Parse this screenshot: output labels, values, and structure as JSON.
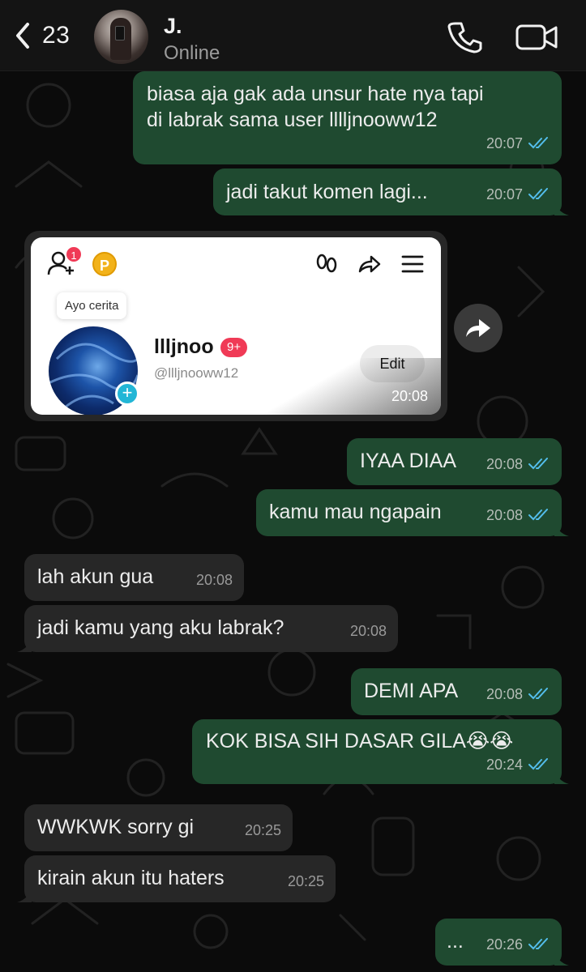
{
  "header": {
    "back_count": "23",
    "contact_name": "J.",
    "contact_status": "Online"
  },
  "colors": {
    "outgoing_bubble": "#1f4a30",
    "incoming_bubble": "#272727",
    "read_tick": "#53bdeb",
    "background": "#0b0b0b"
  },
  "messages": [
    {
      "dir": "out",
      "lines": [
        "biasa aja gak ada unsur hate nya tapi",
        "di labrak sama user lllljnooww12"
      ],
      "time": "20:07",
      "read": true
    },
    {
      "dir": "out",
      "lines": [
        "jadi takut komen lagi..."
      ],
      "time": "20:07",
      "read": true
    },
    {
      "dir": "out",
      "lines": [
        "IYAA DIAA"
      ],
      "time": "20:08",
      "read": true
    },
    {
      "dir": "out",
      "lines": [
        "kamu mau ngapain"
      ],
      "time": "20:08",
      "read": true
    },
    {
      "dir": "in",
      "lines": [
        "lah akun gua"
      ],
      "time": "20:08"
    },
    {
      "dir": "in",
      "lines": [
        "jadi kamu yang aku labrak?"
      ],
      "time": "20:08"
    },
    {
      "dir": "out",
      "lines": [
        "DEMI APA"
      ],
      "time": "20:08",
      "read": true
    },
    {
      "dir": "out",
      "lines": [
        "KOK BISA SIH DASAR GILA😭😭"
      ],
      "time": "20:24",
      "read": true
    },
    {
      "dir": "in",
      "lines": [
        "WWKWK sorry gi"
      ],
      "time": "20:25"
    },
    {
      "dir": "in",
      "lines": [
        "kirain akun itu haters"
      ],
      "time": "20:25"
    },
    {
      "dir": "out",
      "lines": [
        "..."
      ],
      "time": "20:26",
      "read": true
    }
  ],
  "shared_image": {
    "time": "20:08",
    "notification_count": "1",
    "coin_letter": "P",
    "tooltip": "Ayo cerita",
    "profile_name": "llljnoo",
    "badge": "9+",
    "handle": "@llljnooww12",
    "edit_label": "Edit"
  }
}
